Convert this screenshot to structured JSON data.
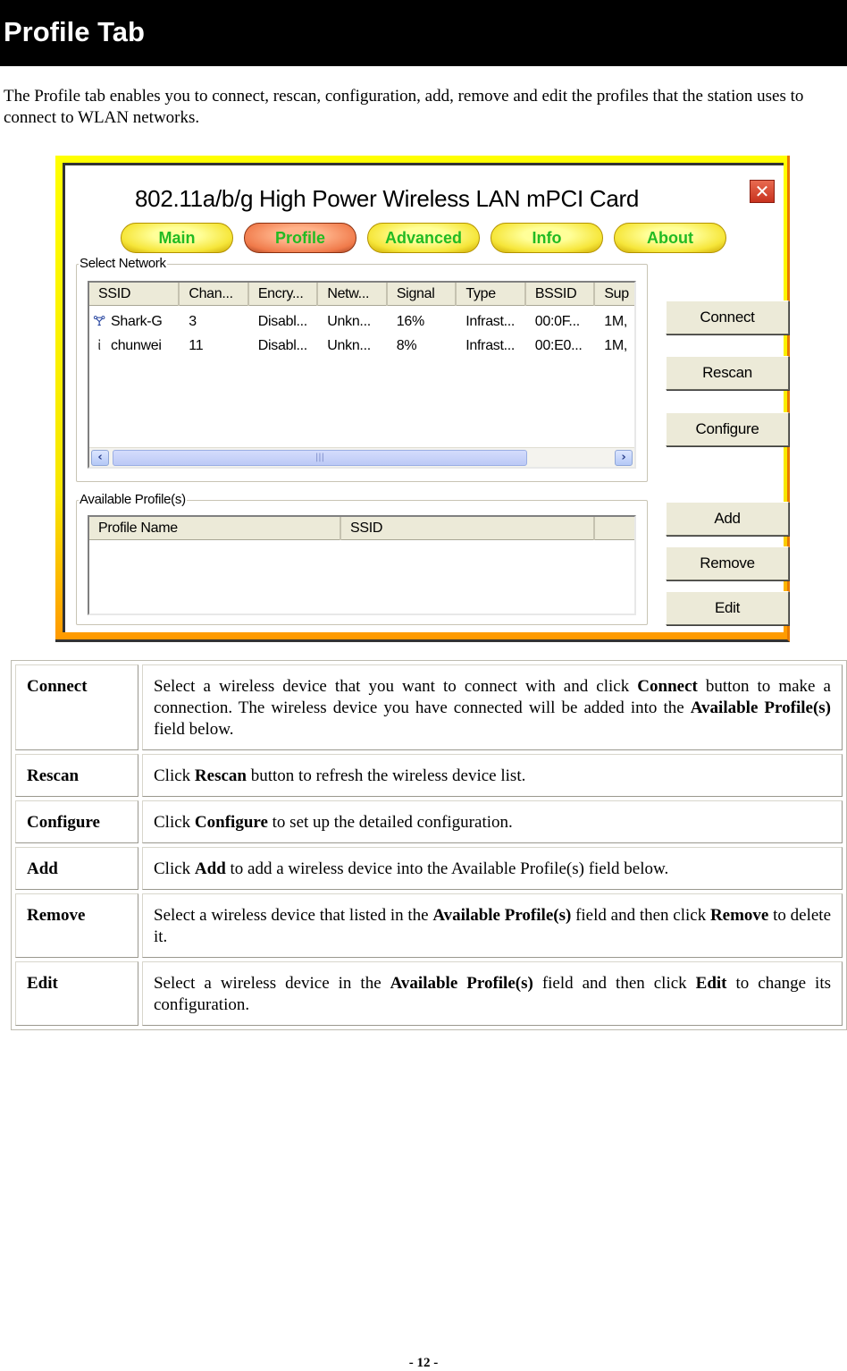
{
  "section": {
    "title": "Profile Tab",
    "intro": "The Profile tab enables you to connect, rescan, configuration, add, remove and edit the profiles that the station uses to connect to WLAN networks."
  },
  "app": {
    "title": "802.11a/b/g High Power Wireless LAN mPCI Card",
    "close_icon": "close-icon",
    "tabs": [
      {
        "label": "Main",
        "active": false
      },
      {
        "label": "Profile",
        "active": true
      },
      {
        "label": "Advanced",
        "active": false
      },
      {
        "label": "Info",
        "active": false
      },
      {
        "label": "About",
        "active": false
      }
    ],
    "select_network": {
      "label": "Select Network",
      "columns": [
        "SSID",
        "Chan...",
        "Encry...",
        "Netw...",
        "Signal",
        "Type",
        "BSSID",
        "Sup"
      ],
      "rows": [
        {
          "icon": "access-point-icon",
          "cells": [
            "Shark-G",
            "3",
            "Disabl...",
            "Unkn...",
            "16%",
            "Infrast...",
            "00:0F...",
            "1M,"
          ]
        },
        {
          "icon": "station-icon",
          "cells": [
            "chunwei",
            "11",
            "Disabl...",
            "Unkn...",
            "8%",
            "Infrast...",
            "00:E0...",
            "1M,"
          ]
        }
      ],
      "scroll_left": "‹",
      "scroll_right": "›",
      "scroll_grip": "|||"
    },
    "available_profiles": {
      "label": "Available Profile(s)",
      "columns": [
        "Profile Name",
        "SSID",
        ""
      ],
      "rows": []
    },
    "buttons": {
      "connect": "Connect",
      "rescan": "Rescan",
      "configure": "Configure",
      "add": "Add",
      "remove": "Remove",
      "edit": "Edit"
    },
    "colors": {
      "frame_top": "#ffff00",
      "frame_bottom": "#ff9900",
      "tab_text": "#22bb22",
      "active_tab": "#f07a4a"
    }
  },
  "descriptions": [
    {
      "term": "Connect",
      "parts": [
        {
          "t": "Select a wireless device that you want to connect with and click "
        },
        {
          "t": "Connect",
          "b": true
        },
        {
          "t": " button to make a connection. The wireless device you have connected will be added into the "
        },
        {
          "t": "Available Profile(s)",
          "b": true
        },
        {
          "t": " field below."
        }
      ]
    },
    {
      "term": "Rescan",
      "parts": [
        {
          "t": "Click "
        },
        {
          "t": "Rescan",
          "b": true
        },
        {
          "t": " button to refresh the wireless device list."
        }
      ]
    },
    {
      "term": "Configure",
      "parts": [
        {
          "t": "Click "
        },
        {
          "t": "Configure",
          "b": true
        },
        {
          "t": " to set up the detailed configuration."
        }
      ]
    },
    {
      "term": "Add",
      "parts": [
        {
          "t": "Click "
        },
        {
          "t": "Add",
          "b": true
        },
        {
          "t": " to add a wireless device into the Available Profile(s) field below."
        }
      ]
    },
    {
      "term": "Remove",
      "parts": [
        {
          "t": "Select a wireless device that listed in the "
        },
        {
          "t": "Available Profile(s)",
          "b": true
        },
        {
          "t": " field and then click "
        },
        {
          "t": "Remove",
          "b": true
        },
        {
          "t": " to delete it."
        }
      ]
    },
    {
      "term": "Edit",
      "parts": [
        {
          "t": "Select a wireless device in the "
        },
        {
          "t": "Available Profile(s)",
          "b": true
        },
        {
          "t": " field and then click "
        },
        {
          "t": "Edit",
          "b": true
        },
        {
          "t": " to change its configuration."
        }
      ]
    }
  ],
  "page_number": "- 12 -"
}
